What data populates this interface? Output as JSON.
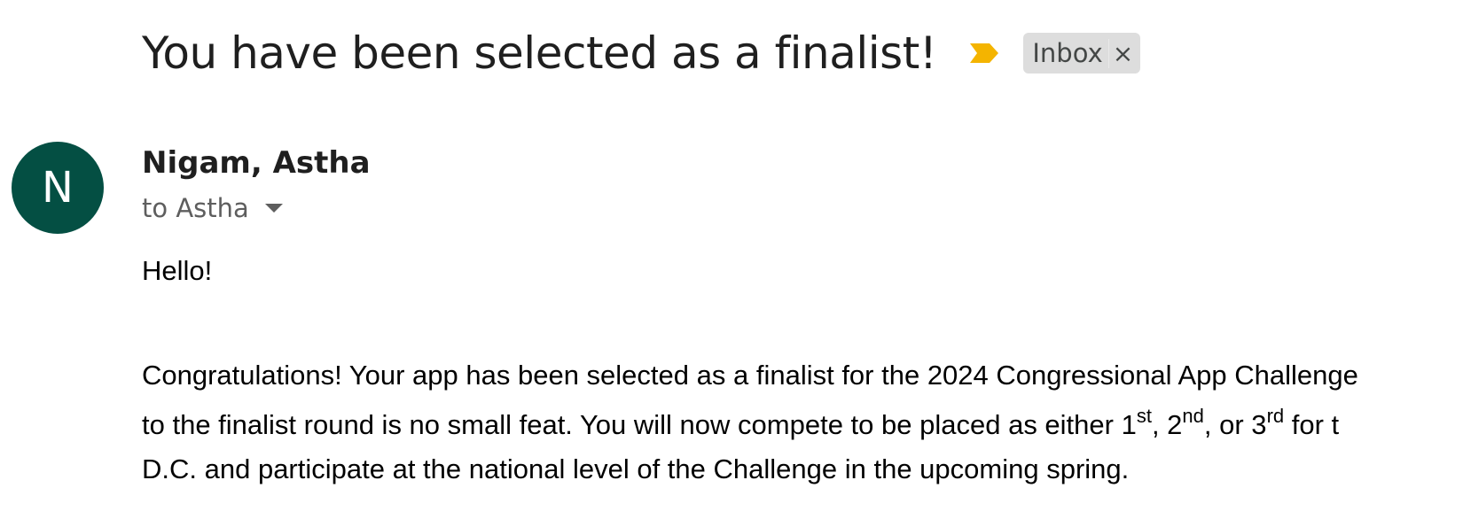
{
  "email": {
    "subject": "You have been selected as a finalist!",
    "label": "Inbox",
    "label_remove": "×",
    "importance_color": "#f4b400",
    "sender": {
      "initial": "N",
      "name": "Nigam, Astha",
      "avatar_color": "#044f43"
    },
    "recipient_text": "to Astha",
    "body": {
      "greeting": "Hello!",
      "line1": "Congratulations! Your app has been selected as a finalist for the 2024 Congressional App Challenge",
      "line2_part1": "to the finalist round is no small feat. You will now compete to be placed as either 1",
      "line2_sup1": "st",
      "line2_part2": ", 2",
      "line2_sup2": "nd",
      "line2_part3": ", or 3",
      "line2_sup3": "rd",
      "line2_part4": " for t",
      "line3": "D.C. and participate at the national level of the Challenge in the upcoming spring."
    }
  }
}
